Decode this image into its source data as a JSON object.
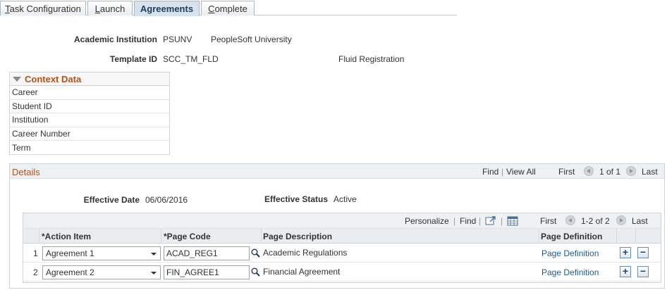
{
  "tabs": [
    {
      "label": "Task Configuration",
      "accel": "T",
      "rest": "ask Configuration"
    },
    {
      "label": "Launch",
      "accel": "L",
      "rest": "aunch"
    },
    {
      "label": "Agreements"
    },
    {
      "label": "Complete",
      "accel": "C",
      "rest": "omplete"
    }
  ],
  "header": {
    "institution_label": "Academic Institution",
    "institution_code": "PSUNV",
    "institution_name": "PeopleSoft University",
    "template_label": "Template ID",
    "template_id": "SCC_TM_FLD",
    "template_desc": "Fluid Registration"
  },
  "context": {
    "title": "Context Data",
    "rows": [
      "Career",
      "Student ID",
      "Institution",
      "Career Number",
      "Term"
    ]
  },
  "details": {
    "title": "Details",
    "find": "Find",
    "sep": "|",
    "view_all": "View All",
    "first": "First",
    "range": "1 of 1",
    "last": "Last",
    "eff_date_label": "Effective Date",
    "eff_date": "06/06/2016",
    "eff_status_label": "Effective Status",
    "eff_status": "Active"
  },
  "grid": {
    "personalize": "Personalize",
    "sep": "|",
    "find": "Find",
    "first": "First",
    "range": "1-2 of 2",
    "last": "Last",
    "columns": {
      "action_item": "*Action Item",
      "page_code": "*Page Code",
      "page_description": "Page Description",
      "page_definition": "Page Definition"
    },
    "rows": [
      {
        "num": "1",
        "action": "Agreement 1",
        "code": "ACAD_REG1",
        "desc": "Academic Regulations",
        "def": "Page Definition"
      },
      {
        "num": "2",
        "action": "Agreement 2",
        "code": "FIN_AGREE1",
        "desc": "Financial Agreement",
        "def": "Page Definition"
      }
    ],
    "add_symbol": "+",
    "remove_symbol": "−"
  },
  "colors": {
    "section_title": "#b0521a",
    "link": "#1a5b96",
    "active_tab": "#d6e3ee"
  }
}
